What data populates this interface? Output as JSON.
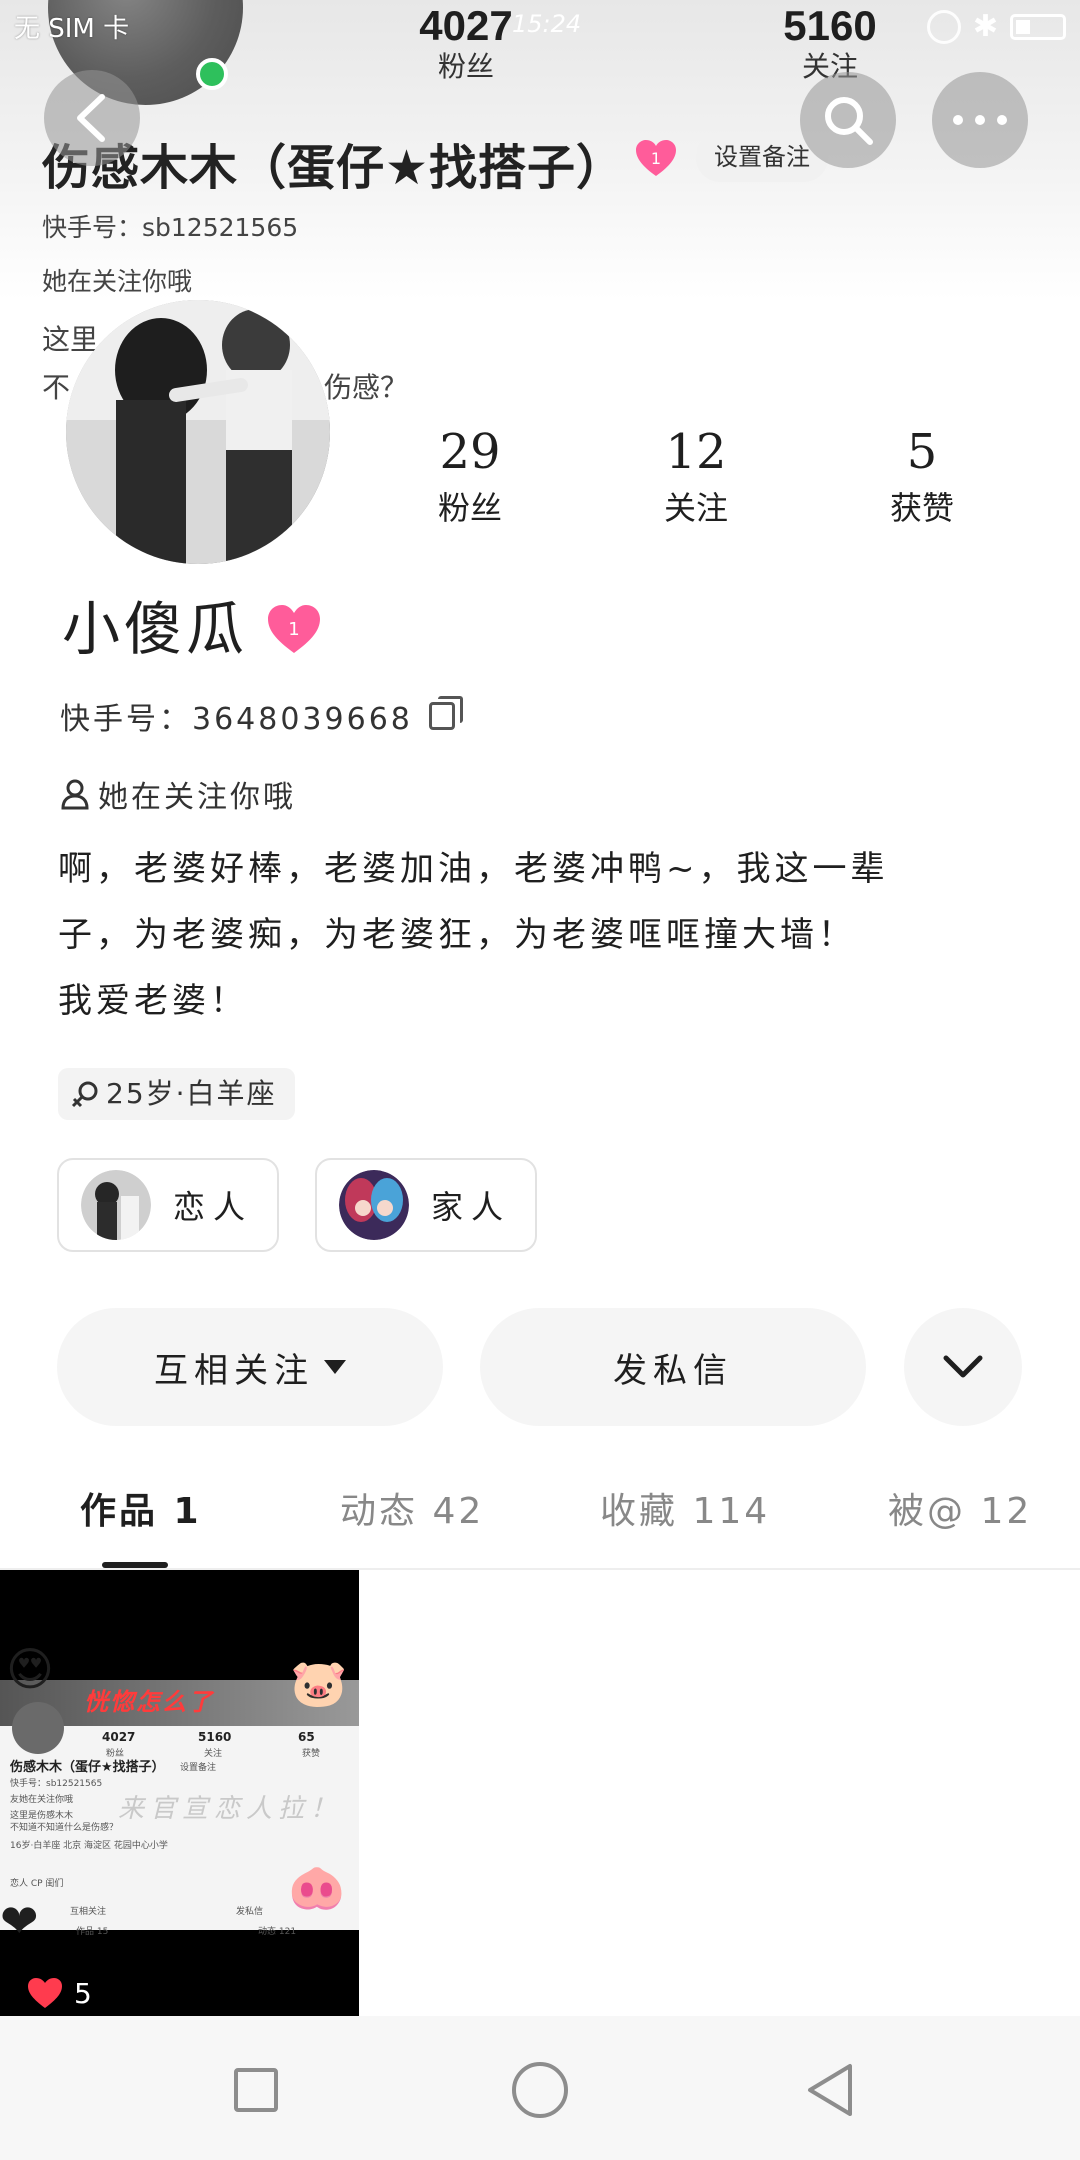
{
  "status_bar": {
    "carrier": "无 SIM 卡",
    "time": "15:24"
  },
  "bg_profile": {
    "fans_count": "4027",
    "fans_label": "粉丝",
    "following_count": "5160",
    "following_label": "关注",
    "name": "伤感木木（蛋仔★找搭子）",
    "heart_level": "1",
    "remark_button": "设置备注",
    "kuaishou_id": "快手号：sb12521565",
    "follows_you": "她在关注你哦",
    "signature_start": "这里",
    "signature_line2_start": "不",
    "signature_line2_end": "伤感？"
  },
  "profile": {
    "stats": [
      {
        "num": "29",
        "label": "粉丝"
      },
      {
        "num": "12",
        "label": "关注"
      },
      {
        "num": "5",
        "label": "获赞"
      }
    ],
    "name": "小傻瓜",
    "heart_level": "1",
    "kuaishou_id": "快手号：3648039668",
    "follows_you": "她在关注你哦",
    "bio_lines": [
      "啊，老婆好棒，老婆加油，老婆冲鸭~，我这一辈",
      "子，为老婆痴，为老婆狂，为老婆哐哐撞大墙！",
      "我爱老婆！"
    ],
    "age_tag": "25岁·白羊座",
    "relations": [
      {
        "label": "恋人"
      },
      {
        "label": "家人"
      }
    ]
  },
  "actions": {
    "follow": "互相关注",
    "message": "发私信"
  },
  "tabs": [
    {
      "label": "作品 1"
    },
    {
      "label": "动态 42"
    },
    {
      "label": "收藏 114"
    },
    {
      "label": "被@ 12"
    }
  ],
  "video": {
    "overlay_title": "恍惚怎么了",
    "overlay_text": "来官宣恋人拉！",
    "mini_fans": "4027",
    "mini_fans_label": "粉丝",
    "mini_following": "5160",
    "mini_following_label": "关注",
    "mini_likes": "65",
    "mini_likes_label": "获赞",
    "mini_name": "伤感木木（蛋仔★找搭子）",
    "mini_remark": "设置备注",
    "mini_id": "快手号：sb12521565",
    "mini_follows": "友她在关注你哦",
    "mini_sig1": "这里是伤感木木",
    "mini_sig2": "不知道不知道什么是伤感？",
    "mini_tags": "16岁·白羊座   北京 海淀区   花园中心小学",
    "mini_rel": "恋人      CP      闺们",
    "mini_follow_btn": "互相关注",
    "mini_msg_btn": "发私信",
    "mini_tab1": "作品 15",
    "mini_tab2": "动态 121",
    "like_count": "5"
  },
  "colors": {
    "online": "#2ec05c",
    "heart_pink": "#ff5c9a",
    "like_red": "#ff3b4e"
  }
}
